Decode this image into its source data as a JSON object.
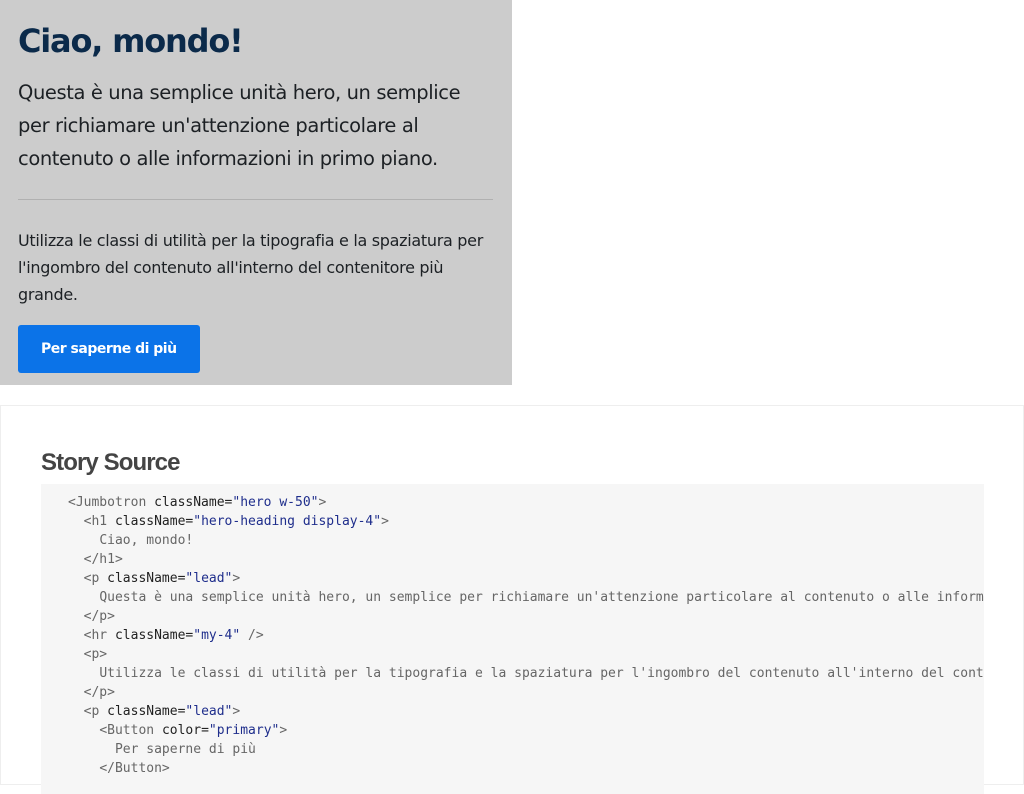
{
  "jumbotron": {
    "heading": "Ciao, mondo!",
    "lead": "Questa è una semplice unità hero, un semplice per richiamare un'attenzione particolare al contenuto o alle informazioni in primo piano.",
    "body": "Utilizza le classi di utilità per la tipografia e la spaziatura per l'ingombro del contenuto all'interno del contenitore più grande.",
    "button_label": "Per saperne di più"
  },
  "story_source": {
    "title": "Story Source",
    "code": {
      "l1_tag": "<Jumbotron ",
      "l1_attr": "className=",
      "l1_str": "\"hero w-50\"",
      "l1_close": ">",
      "l2_tag": "<h1 ",
      "l2_attr": "className=",
      "l2_str": "\"hero-heading display-4\"",
      "l2_close": ">",
      "l3_text": "Ciao, mondo!",
      "l4_tag": "</h1>",
      "l5_tag": "<p ",
      "l5_attr": "className=",
      "l5_str": "\"lead\"",
      "l5_close": ">",
      "l6_text": "Questa è una semplice unità hero, un semplice per richiamare un'attenzione particolare al contenuto o alle informazioni in primo piano.",
      "l7_tag": "</p>",
      "l8_tag": "<hr ",
      "l8_attr": "className=",
      "l8_str": "\"my-4\"",
      "l8_close": " />",
      "l9_tag": "<p>",
      "l10_text": "Utilizza le classi di utilità per la tipografia e la spaziatura per l'ingombro del contenuto all'interno del contenitore più grande.",
      "l11_tag": "</p>",
      "l12_tag": "<p ",
      "l12_attr": "className=",
      "l12_str": "\"lead\"",
      "l12_close": ">",
      "l13_tag": "<Button ",
      "l13_attr": "color=",
      "l13_str": "\"primary\"",
      "l13_close": ">",
      "l14_text": "Per saperne di più",
      "l15_tag": "</Button>"
    }
  }
}
